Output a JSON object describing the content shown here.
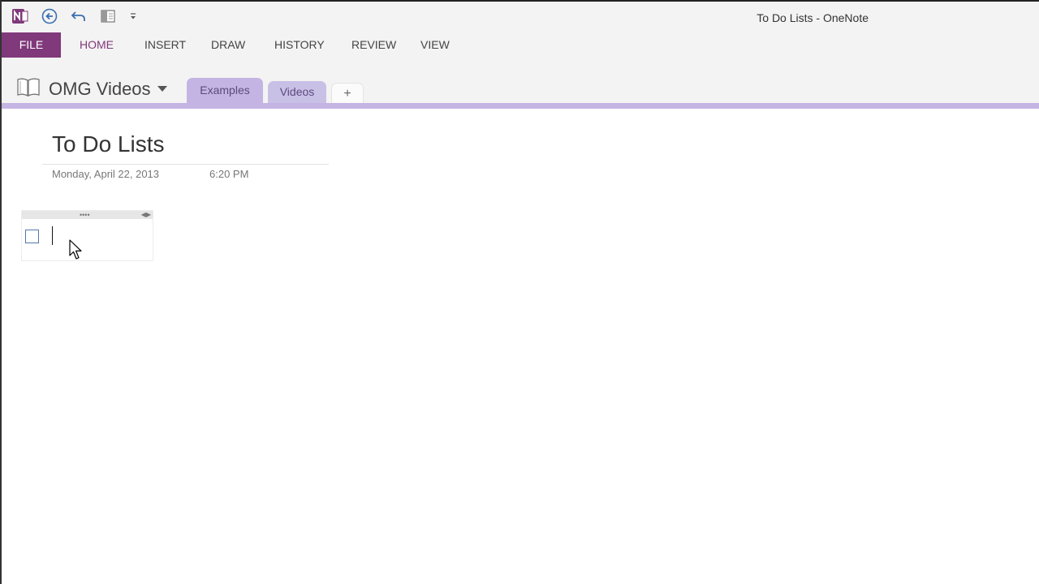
{
  "window": {
    "title": "To Do Lists - OneNote"
  },
  "quick_access": [
    {
      "name": "onenote-logo-icon"
    },
    {
      "name": "back-icon"
    },
    {
      "name": "undo-icon"
    },
    {
      "name": "dock-to-desktop-icon"
    },
    {
      "name": "customize-toolbar-icon"
    }
  ],
  "ribbon": {
    "tabs": [
      {
        "id": "file",
        "label": "FILE"
      },
      {
        "id": "home",
        "label": "HOME"
      },
      {
        "id": "insert",
        "label": "INSERT"
      },
      {
        "id": "draw",
        "label": "DRAW"
      },
      {
        "id": "history",
        "label": "HISTORY"
      },
      {
        "id": "review",
        "label": "REVIEW"
      },
      {
        "id": "view",
        "label": "VIEW"
      }
    ]
  },
  "notebook": {
    "name": "OMG Videos",
    "sections": [
      {
        "label": "Examples",
        "active": true
      },
      {
        "label": "Videos",
        "active": false
      }
    ],
    "add_section_label": "+"
  },
  "page": {
    "title": "To Do Lists",
    "date": "Monday, April 22, 2013",
    "time": "6:20 PM"
  },
  "colors": {
    "accent": "#80397b",
    "section_examples": "#c4b4e3",
    "section_videos": "#c9c0e6"
  }
}
